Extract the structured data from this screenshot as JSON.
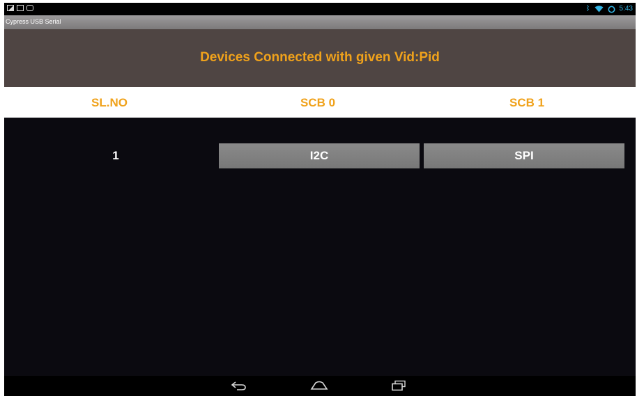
{
  "status_bar": {
    "left_icons": [
      "gallery-icon",
      "screen-icon",
      "usb-icon"
    ],
    "right_icons": [
      "bluetooth-icon",
      "wifi-icon",
      "battery-icon"
    ],
    "time": "5:43",
    "accent_color": "#33b5e5"
  },
  "app": {
    "title": "Cypress USB Serial"
  },
  "header": {
    "text": "Devices Connected with given Vid:Pid",
    "text_color": "#f0a21b",
    "background": "#4f4543"
  },
  "table": {
    "columns": [
      "SL.NO",
      "SCB 0",
      "SCB 1"
    ],
    "rows": [
      {
        "sl_no": "1",
        "scb0": "I2C",
        "scb1": "SPI"
      }
    ]
  },
  "nav_bar": {
    "buttons": [
      "back-icon",
      "home-icon",
      "recent-apps-icon"
    ]
  }
}
